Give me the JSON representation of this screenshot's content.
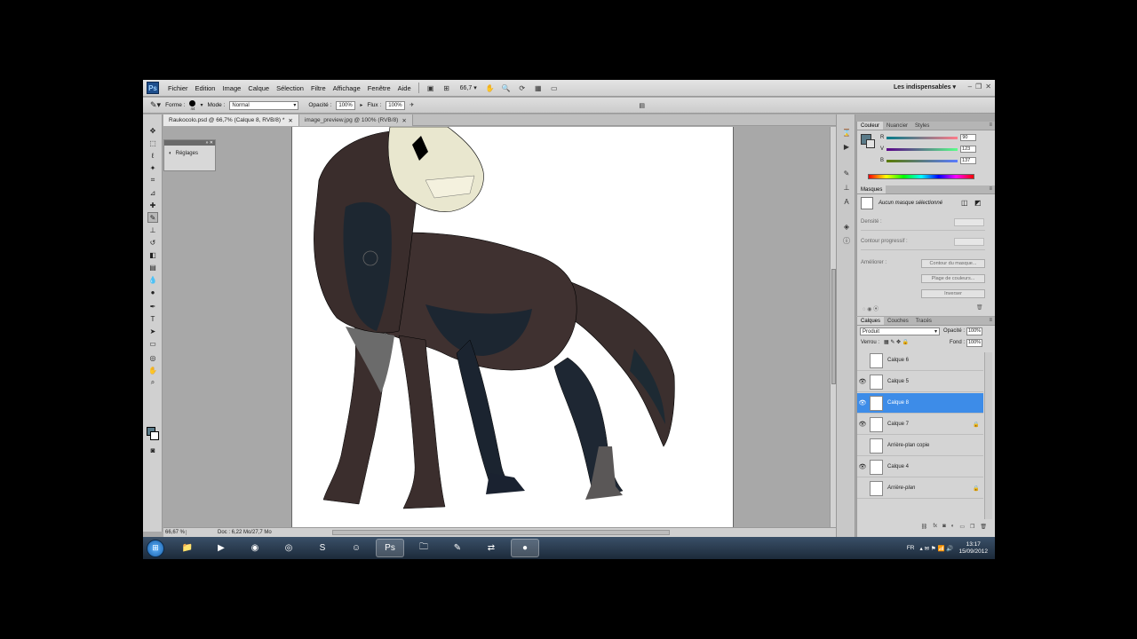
{
  "menubar": {
    "logo": "Ps",
    "items": [
      "Fichier",
      "Edition",
      "Image",
      "Calque",
      "Sélection",
      "Filtre",
      "Affichage",
      "Fenêtre",
      "Aide"
    ],
    "zoom": "66,7",
    "workspace": "Les indispensables"
  },
  "options": {
    "forme_label": "Forme :",
    "brush_size": "44",
    "mode_label": "Mode :",
    "mode_value": "Normal",
    "opacite_label": "Opacité :",
    "opacite_value": "100%",
    "flux_label": "Flux :",
    "flux_value": "100%"
  },
  "tabs": [
    {
      "label": "Raukocolo.psd @ 66,7% (Calque 8, RVB/8) *"
    },
    {
      "label": "image_preview.jpg @ 100% (RVB/8)"
    }
  ],
  "reglages": {
    "label": "Réglages"
  },
  "status": {
    "zoom": "66,67 %",
    "doc": "Doc : 6,22 Mo/27,7 Mo"
  },
  "couleur": {
    "tabs": [
      "Couleur",
      "Nuancier",
      "Styles"
    ],
    "r_label": "R",
    "r_value": "90",
    "v_label": "V",
    "v_value": "123",
    "b_label": "B",
    "b_value": "137",
    "fg_color": "#5a7b89"
  },
  "masques": {
    "tab": "Masques",
    "status": "Aucun masque sélectionné",
    "densite": "Densité :",
    "contour": "Contour progressif :",
    "amelior": "Améliorer :",
    "btn_contour": "Contour du masque...",
    "btn_plage": "Plage de couleurs...",
    "btn_inverser": "Inverser"
  },
  "calques": {
    "tabs": [
      "Calques",
      "Couches",
      "Tracés"
    ],
    "blend_mode": "Produit",
    "opacite_label": "Opacité :",
    "opacite_value": "100%",
    "verrou_label": "Verrou :",
    "fond_label": "Fond :",
    "fond_value": "100%",
    "layers": [
      {
        "name": "Calque 6",
        "visible": false,
        "selected": false,
        "locked": false
      },
      {
        "name": "Calque 5",
        "visible": true,
        "selected": false,
        "locked": false
      },
      {
        "name": "Calque 8",
        "visible": true,
        "selected": true,
        "locked": false
      },
      {
        "name": "Calque 7",
        "visible": true,
        "selected": false,
        "locked": true
      },
      {
        "name": "Arrière-plan copie",
        "visible": false,
        "selected": false,
        "locked": false
      },
      {
        "name": "Calque 4",
        "visible": true,
        "selected": false,
        "locked": false
      },
      {
        "name": "Arrière-plan",
        "visible": false,
        "selected": false,
        "locked": true
      }
    ]
  },
  "taskbar": {
    "lang": "FR",
    "time": "13:17",
    "date": "15/09/2012"
  }
}
